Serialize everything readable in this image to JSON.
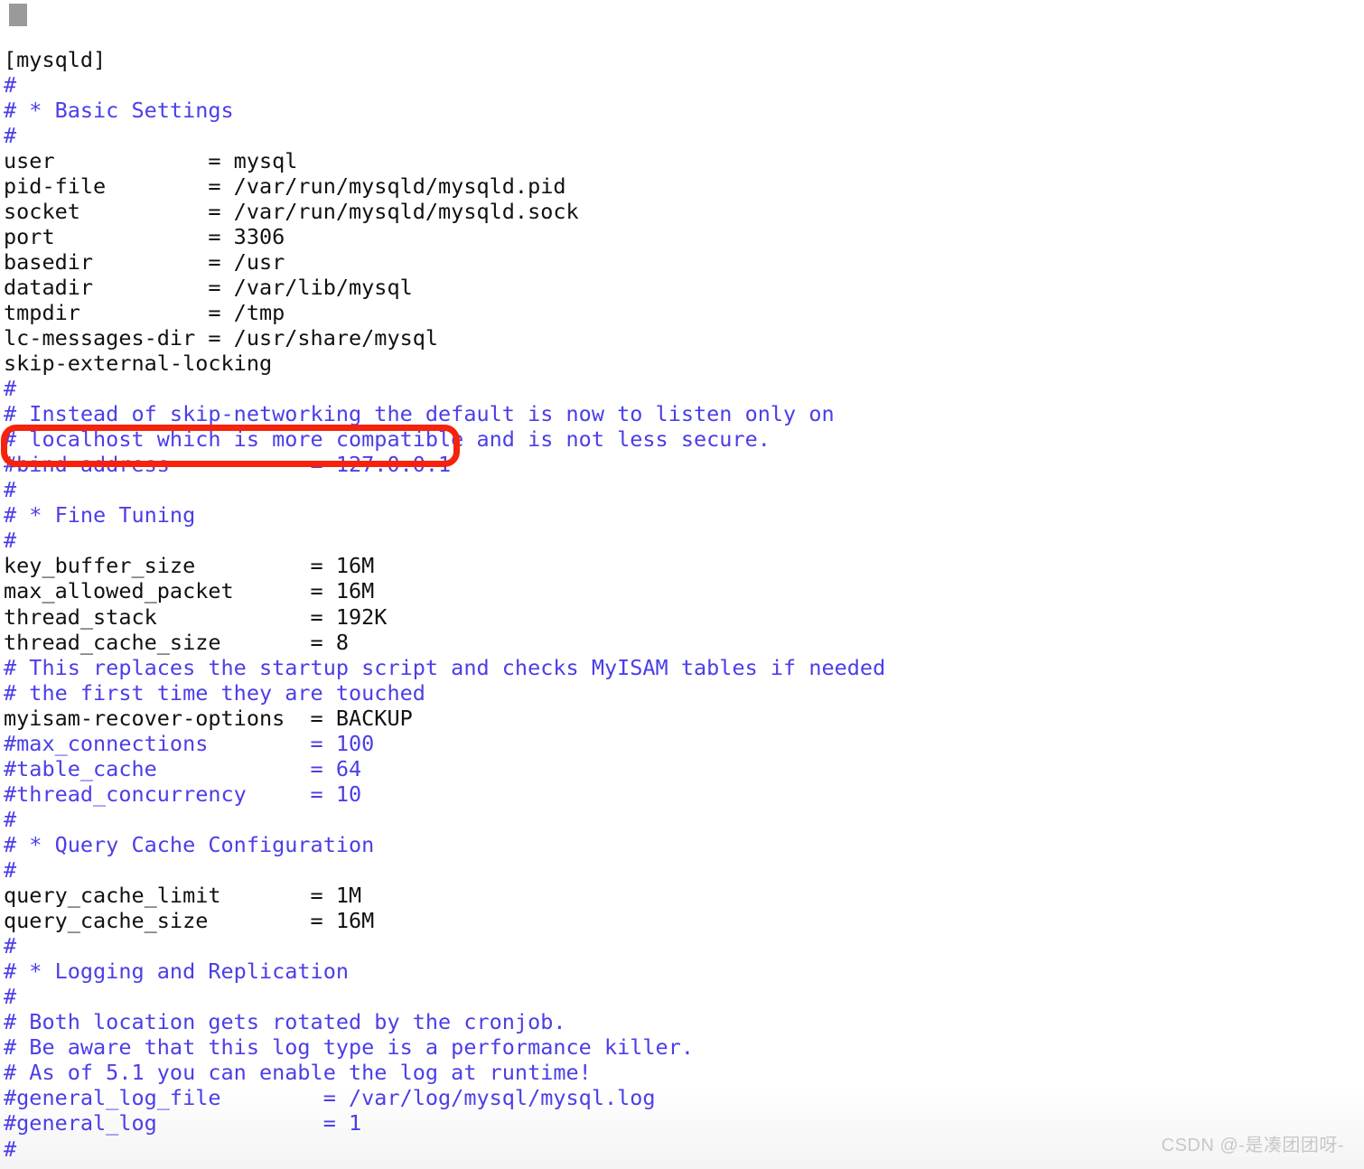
{
  "document": {
    "kind": "terminal-text-editor",
    "file_section": "[mysqld]",
    "background_color": "#ffffff",
    "text_color": "#111111",
    "comment_color": "#4b3ee8",
    "cursor_color": "#9a9a9a",
    "annotation_color": "#f6220a"
  },
  "cursor": {
    "name": "text-cursor-block"
  },
  "lines": [
    {
      "i": 0,
      "comment": false,
      "text": "[mysqld]"
    },
    {
      "i": 1,
      "comment": true,
      "text": "#"
    },
    {
      "i": 2,
      "comment": true,
      "text": "# * Basic Settings"
    },
    {
      "i": 3,
      "comment": true,
      "text": "#"
    },
    {
      "i": 4,
      "comment": false,
      "text": "user            = mysql"
    },
    {
      "i": 5,
      "comment": false,
      "text": "pid-file        = /var/run/mysqld/mysqld.pid"
    },
    {
      "i": 6,
      "comment": false,
      "text": "socket          = /var/run/mysqld/mysqld.sock"
    },
    {
      "i": 7,
      "comment": false,
      "text": "port            = 3306"
    },
    {
      "i": 8,
      "comment": false,
      "text": "basedir         = /usr"
    },
    {
      "i": 9,
      "comment": false,
      "text": "datadir         = /var/lib/mysql"
    },
    {
      "i": 10,
      "comment": false,
      "text": "tmpdir          = /tmp"
    },
    {
      "i": 11,
      "comment": false,
      "text": "lc-messages-dir = /usr/share/mysql"
    },
    {
      "i": 12,
      "comment": false,
      "text": "skip-external-locking"
    },
    {
      "i": 13,
      "comment": true,
      "text": "#"
    },
    {
      "i": 14,
      "comment": true,
      "text": "# Instead of skip-networking the default is now to listen only on"
    },
    {
      "i": 15,
      "comment": true,
      "text": "# localhost which is more compatible and is not less secure."
    },
    {
      "i": 16,
      "comment": true,
      "text": "#bind-address           = 127.0.0.1"
    },
    {
      "i": 17,
      "comment": true,
      "text": "#"
    },
    {
      "i": 18,
      "comment": true,
      "text": "# * Fine Tuning"
    },
    {
      "i": 19,
      "comment": true,
      "text": "#"
    },
    {
      "i": 20,
      "comment": false,
      "text": "key_buffer_size         = 16M"
    },
    {
      "i": 21,
      "comment": false,
      "text": "max_allowed_packet      = 16M"
    },
    {
      "i": 22,
      "comment": false,
      "text": "thread_stack            = 192K"
    },
    {
      "i": 23,
      "comment": false,
      "text": "thread_cache_size       = 8"
    },
    {
      "i": 24,
      "comment": true,
      "text": "# This replaces the startup script and checks MyISAM tables if needed"
    },
    {
      "i": 25,
      "comment": true,
      "text": "# the first time they are touched"
    },
    {
      "i": 26,
      "comment": false,
      "text": "myisam-recover-options  = BACKUP"
    },
    {
      "i": 27,
      "comment": true,
      "text": "#max_connections        = 100"
    },
    {
      "i": 28,
      "comment": true,
      "text": "#table_cache            = 64"
    },
    {
      "i": 29,
      "comment": true,
      "text": "#thread_concurrency     = 10"
    },
    {
      "i": 30,
      "comment": true,
      "text": "#"
    },
    {
      "i": 31,
      "comment": true,
      "text": "# * Query Cache Configuration"
    },
    {
      "i": 32,
      "comment": true,
      "text": "#"
    },
    {
      "i": 33,
      "comment": false,
      "text": "query_cache_limit       = 1M"
    },
    {
      "i": 34,
      "comment": false,
      "text": "query_cache_size        = 16M"
    },
    {
      "i": 35,
      "comment": true,
      "text": "#"
    },
    {
      "i": 36,
      "comment": true,
      "text": "# * Logging and Replication"
    },
    {
      "i": 37,
      "comment": true,
      "text": "#"
    },
    {
      "i": 38,
      "comment": true,
      "text": "# Both location gets rotated by the cronjob."
    },
    {
      "i": 39,
      "comment": true,
      "text": "# Be aware that this log type is a performance killer."
    },
    {
      "i": 40,
      "comment": true,
      "text": "# As of 5.1 you can enable the log at runtime!"
    },
    {
      "i": 41,
      "comment": true,
      "text": "#general_log_file        = /var/log/mysql/mysql.log"
    },
    {
      "i": 42,
      "comment": true,
      "text": "#general_log             = 1"
    },
    {
      "i": 43,
      "comment": true,
      "text": "#"
    }
  ],
  "settings": {
    "user": "mysql",
    "pid-file": "/var/run/mysqld/mysqld.pid",
    "socket": "/var/run/mysqld/mysqld.sock",
    "port": "3306",
    "basedir": "/usr",
    "datadir": "/var/lib/mysql",
    "tmpdir": "/tmp",
    "lc-messages-dir": "/usr/share/mysql",
    "skip-external-locking": "",
    "bind-address": "127.0.0.1",
    "key_buffer_size": "16M",
    "max_allowed_packet": "16M",
    "thread_stack": "192K",
    "thread_cache_size": "8",
    "myisam-recover-options": "BACKUP",
    "max_connections": "100",
    "table_cache": "64",
    "thread_concurrency": "10",
    "query_cache_limit": "1M",
    "query_cache_size": "16M",
    "general_log_file": "/var/log/mysql/mysql.log",
    "general_log": "1"
  },
  "annotation": {
    "label": "highlight-bind-address",
    "target_line_index": 16,
    "target_text": "#bind-address           = 127.0.0.1",
    "shape": "rounded-rectangle",
    "color": "#f6220a"
  },
  "watermark": {
    "text": "CSDN @-是凑团团呀-"
  }
}
